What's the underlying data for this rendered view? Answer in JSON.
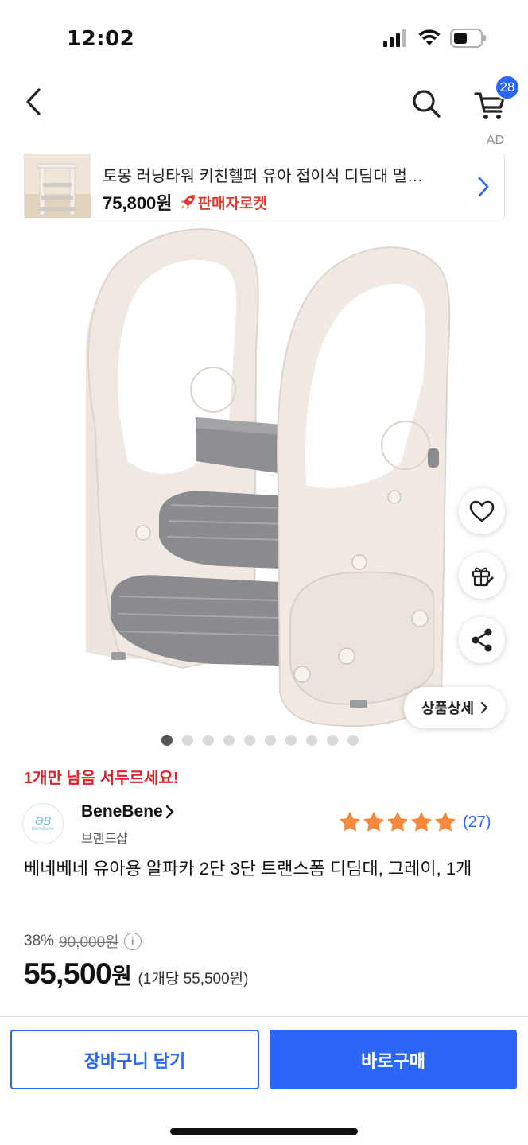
{
  "status_bar": {
    "time": "12:02"
  },
  "header": {
    "cart_count": "28"
  },
  "ad": {
    "label": "AD",
    "title": "토몽 러닝타워 키친헬퍼 유아 접이식 디딤대 멀…",
    "price": "75,800원",
    "delivery_badge": "판매자로켓"
  },
  "gallery": {
    "detail_label": "상품상세",
    "image_count": 10,
    "active_index": 0
  },
  "product": {
    "stock_warning": "1개만 남음 서두르세요!",
    "brand_name": "BeneBene",
    "brand_shop": "브랜드샵",
    "brand_logo_mark": "ƏB",
    "brand_logo_text": "BeneBene",
    "rating_stars": 5,
    "review_count": "(27)",
    "title": "베네베네 유아용 알파카 2단 3단 트랜스폼 디딤대, 그레이, 1개",
    "discount_rate": "38%",
    "original_price": "90,000원",
    "sale_price_number": "55,500",
    "sale_price_unit": "원",
    "unit_price": "(1개당 55,500원)"
  },
  "actions": {
    "add_to_cart": "장바구니 담기",
    "buy_now": "바로구매"
  },
  "colors": {
    "accent": "#2b66f6",
    "warning": "#e0222a",
    "star": "#f5883a"
  }
}
